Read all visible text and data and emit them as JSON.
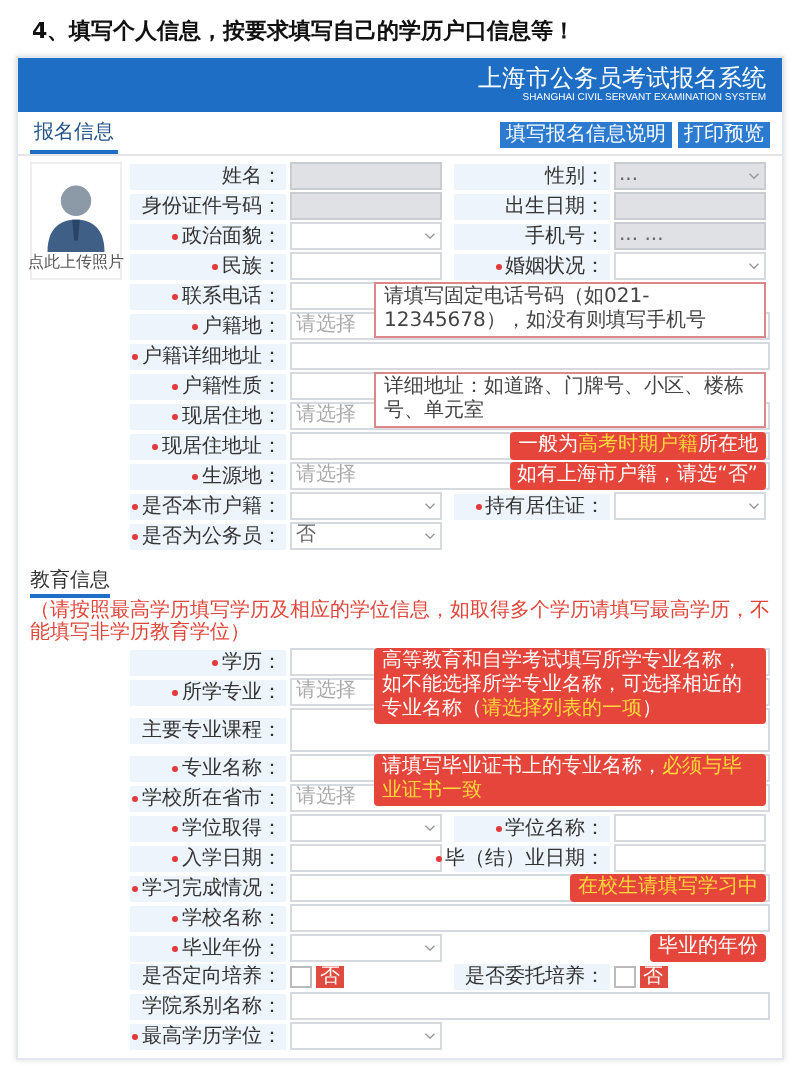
{
  "page_title": "4、填写个人信息，按要求填写自己的学历户口信息等！",
  "banner": {
    "title": "上海市公务员考试报名系统",
    "subtitle": "SHANGHAI CIVIL SERVANT EXAMINATION SYSTEM"
  },
  "tab": {
    "label": "报名信息",
    "selected": true
  },
  "toolbar_buttons": [
    "填写报名信息说明",
    "打印预览"
  ],
  "photo": {
    "caption": "点此上传照片"
  },
  "sections": [
    {
      "rows": [
        {
          "fields": [
            {
              "label": "姓名：",
              "kind": "input",
              "locked": true
            },
            {
              "label": "性别：",
              "kind": "select",
              "value": "...",
              "locked": true
            }
          ]
        },
        {
          "fields": [
            {
              "label": "身份证件号码：",
              "kind": "input",
              "locked": true
            },
            {
              "label": "出生日期：",
              "kind": "input",
              "locked": true
            }
          ]
        },
        {
          "fields": [
            {
              "label": "政治面貌：",
              "required": true,
              "kind": "select"
            },
            {
              "label": "手机号：",
              "kind": "input",
              "value": "...   ...",
              "locked": true
            }
          ]
        },
        {
          "fields": [
            {
              "label": "民族：",
              "required": true,
              "kind": "input"
            },
            {
              "label": "婚姻状况：",
              "required": true,
              "kind": "select"
            }
          ]
        },
        {
          "tip": {
            "text": "请填写固定电话号码（如021-12345678），如没有则填写手机号",
            "kind": "light"
          },
          "fields": [
            {
              "label": "联系电话：",
              "required": true,
              "kind": "input"
            }
          ]
        },
        {
          "wide": true,
          "fields": [
            {
              "label": "户籍地：",
              "required": true,
              "kind": "input",
              "placeholder": "请选择"
            }
          ]
        },
        {
          "wide": true,
          "fields": [
            {
              "label": "户籍详细地址：",
              "required": true,
              "kind": "input"
            }
          ]
        },
        {
          "tip": {
            "text": "详细地址：如道路、门牌号、小区、楼栋号、单元室",
            "kind": "light"
          },
          "fields": [
            {
              "label": "户籍性质：",
              "required": true,
              "kind": "select"
            }
          ]
        },
        {
          "wide": true,
          "fields": [
            {
              "label": "现居住地：",
              "required": true,
              "kind": "input",
              "placeholder": "请选择"
            }
          ]
        },
        {
          "wide": true,
          "tip": {
            "text": "一般为**高考时期户籍**所在地",
            "kind": "red"
          },
          "fields": [
            {
              "label": "现居住地址：",
              "required": true,
              "kind": "input"
            }
          ]
        },
        {
          "wide": true,
          "tip": {
            "text": "如有上海市户籍，请选“否”",
            "kind": "red"
          },
          "fields": [
            {
              "label": "生源地：",
              "required": true,
              "kind": "input",
              "placeholder": "请选择"
            }
          ]
        },
        {
          "fields": [
            {
              "label": "是否本市户籍：",
              "required": true,
              "kind": "select"
            },
            {
              "label": "持有居住证：",
              "required": true,
              "kind": "select"
            }
          ]
        },
        {
          "fields": [
            {
              "label": "是否为公务员：",
              "required": true,
              "kind": "select",
              "value": "否"
            }
          ]
        }
      ]
    },
    {
      "title": "教育信息",
      "note": "（请按照最高学历填写学历及相应的学位信息，如取得多个学历请填写最高学历，不能填写非学历教育学位）",
      "rows": [
        {
          "wide": true,
          "tip": {
            "text": "高等教育和自学考试填写所学专业名称，如不能选择所学专业名称，可选择相近的专业名称（**请选择列表的一项**）",
            "kind": "red"
          },
          "fields": [
            {
              "label": "学历：",
              "required": true,
              "kind": "input"
            }
          ]
        },
        {
          "wide": true,
          "fields": [
            {
              "label": "所学专业：",
              "required": true,
              "kind": "input",
              "placeholder": "请选择"
            }
          ]
        },
        {
          "wide": true,
          "fields": [
            {
              "label": "主要专业课程：",
              "kind": "textarea"
            }
          ]
        },
        {
          "wide": true,
          "tip": {
            "text": "请填写毕业证书上的专业名称，**必须与毕业证书一致**",
            "kind": "red"
          },
          "fields": [
            {
              "label": "专业名称：",
              "required": true,
              "kind": "input"
            }
          ]
        },
        {
          "wide": true,
          "fields": [
            {
              "label": "学校所在省市：",
              "required": true,
              "kind": "input",
              "placeholder": "请选择"
            }
          ]
        },
        {
          "fields": [
            {
              "label": "学位取得：",
              "required": true,
              "kind": "select"
            },
            {
              "label": "学位名称：",
              "required": true,
              "kind": "input"
            }
          ]
        },
        {
          "fields": [
            {
              "label": "入学日期：",
              "required": true,
              "kind": "input"
            },
            {
              "label": "毕（结）业日期：",
              "required": true,
              "kind": "input"
            }
          ]
        },
        {
          "wide": true,
          "tip": {
            "text": "**在校生请填写学习中**",
            "kind": "red"
          },
          "fields": [
            {
              "label": "学习完成情况：",
              "required": true,
              "kind": "input"
            }
          ]
        },
        {
          "wide": true,
          "fields": [
            {
              "label": "学校名称：",
              "required": true,
              "kind": "input"
            }
          ]
        },
        {
          "tip": {
            "text": "毕业的年份",
            "kind": "red"
          },
          "fields": [
            {
              "label": "毕业年份：",
              "required": true,
              "kind": "select"
            }
          ]
        },
        {
          "fields": [
            {
              "label": "是否定向培养：",
              "kind": "check",
              "value": "否",
              "checked": false
            },
            {
              "label": "是否委托培养：",
              "kind": "check",
              "value": "否",
              "checked": false
            }
          ]
        },
        {
          "wide": true,
          "fields": [
            {
              "label": "学院系别名称：",
              "kind": "input"
            }
          ]
        },
        {
          "fields": [
            {
              "label": "最高学历学位：",
              "required": true,
              "kind": "select"
            }
          ]
        }
      ]
    }
  ]
}
